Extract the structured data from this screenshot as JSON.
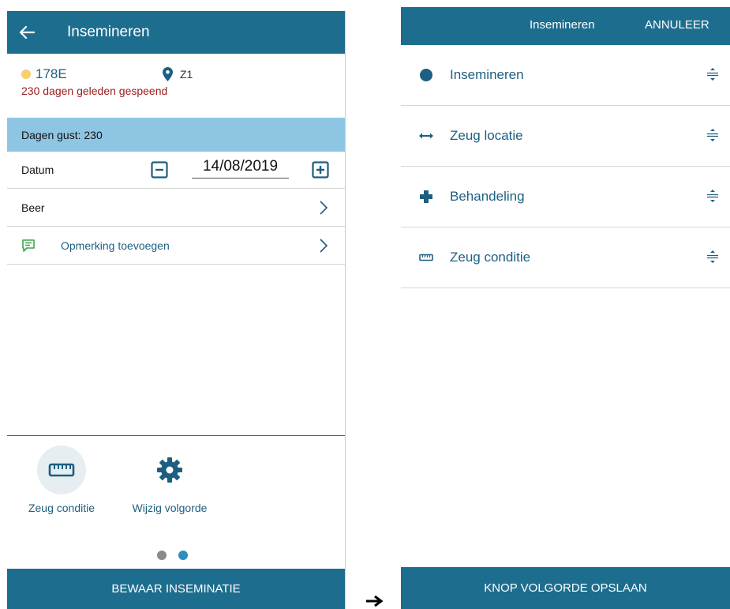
{
  "left_screen": {
    "appbar": {
      "title": "Insemineren",
      "back_icon": "arrow-left-icon"
    },
    "animal": {
      "code": "178E",
      "status_color": "#f6cf6e",
      "location": "Z1",
      "weaned_text": "230 dagen geleden gespeend"
    },
    "gust_text": "Dagen gust: 230",
    "datum": {
      "label": "Datum",
      "value": "14/08/2019"
    },
    "beer": {
      "label": "Beer"
    },
    "opmerking": {
      "label": "Opmerking toevoegen"
    },
    "actions": [
      {
        "label": "Zeug conditie",
        "icon": "ruler-icon"
      },
      {
        "label": "Wijzig volgorde",
        "icon": "gear-icon"
      }
    ],
    "pager": {
      "pages": 2,
      "active": 2
    },
    "save_button": "BEWAAR INSEMINATIE"
  },
  "right_screen": {
    "appbar": {
      "title": "Insemineren",
      "cancel": "ANNULEER"
    },
    "items": [
      {
        "label": "Insemineren",
        "icon": "filled-circle-icon"
      },
      {
        "label": "Zeug locatie",
        "icon": "double-arrow-icon"
      },
      {
        "label": "Behandeling",
        "icon": "plus-cross-icon"
      },
      {
        "label": "Zeug conditie",
        "icon": "ruler-icon"
      }
    ],
    "save_button": "KNOP VOLGORDE OPSLAAN"
  },
  "colors": {
    "primary": "#1d6d8e",
    "highlight_row": "#8ec5e3",
    "text_accent": "#1d5f80",
    "warning_text": "#a01c1c"
  }
}
